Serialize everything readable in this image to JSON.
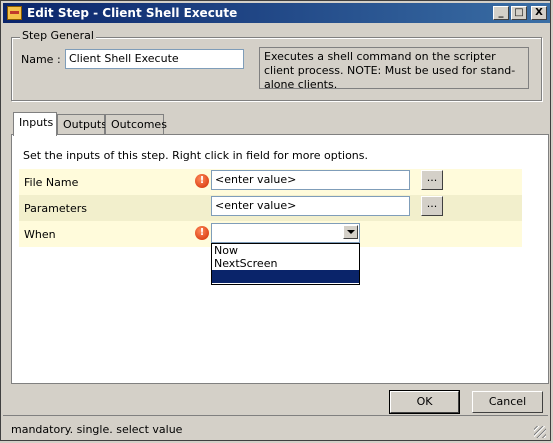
{
  "window": {
    "title": "Edit Step - Client Shell Execute",
    "controls": {
      "minimize": "_",
      "maximize": "□",
      "close": "X"
    }
  },
  "step_general": {
    "group_label": "Step General",
    "name_label": "Name :",
    "name_value": "Client Shell Execute",
    "description": "Executes a shell command on the scripter client process. NOTE: Must be used for stand-alone clients."
  },
  "tabs": [
    {
      "label": "Inputs",
      "active": true
    },
    {
      "label": "Outputs",
      "active": false
    },
    {
      "label": "Outcomes",
      "active": false
    }
  ],
  "inputs": {
    "instructions": "Set the inputs of this step.  Right click in field for more options.",
    "rows": [
      {
        "label": "File Name",
        "mandatory": true,
        "value": "<enter value>",
        "ellipsis": "..."
      },
      {
        "label": "Parameters",
        "mandatory": false,
        "value": "<enter value>",
        "ellipsis": "..."
      },
      {
        "label": "When",
        "mandatory": true,
        "value": ""
      }
    ],
    "when_options": [
      "Now",
      "NextScreen",
      ""
    ]
  },
  "buttons": {
    "ok": "OK",
    "cancel": "Cancel"
  },
  "status": {
    "text": "mandatory. single. select value"
  },
  "icons": {
    "warning": "!"
  }
}
